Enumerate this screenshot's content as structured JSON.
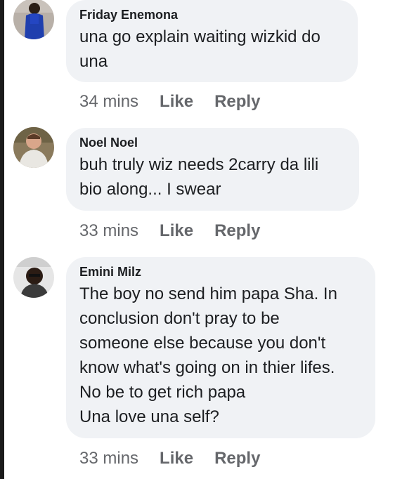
{
  "comments": [
    {
      "author": "Friday Enemona",
      "text": "una go explain waiting wizkid do\nuna",
      "time": "34 mins",
      "like_label": "Like",
      "reply_label": "Reply"
    },
    {
      "author": "Noel Noel",
      "text": "buh truly wiz needs 2carry  da lili\nbio along... I swear",
      "time": "33 mins",
      "like_label": "Like",
      "reply_label": "Reply"
    },
    {
      "author": "Emini Milz",
      "text": "The boy no send him papa Sha. In\nconclusion don't pray to be\nsomeone else because you don't\nknow what's going on in thier lifes.\nNo be to get rich papa\nUna love una self?",
      "time": "33 mins",
      "like_label": "Like",
      "reply_label": "Reply"
    }
  ],
  "colors": {
    "bubble_bg": "#f0f2f5",
    "text": "#1c1e21",
    "meta": "#65676b"
  }
}
